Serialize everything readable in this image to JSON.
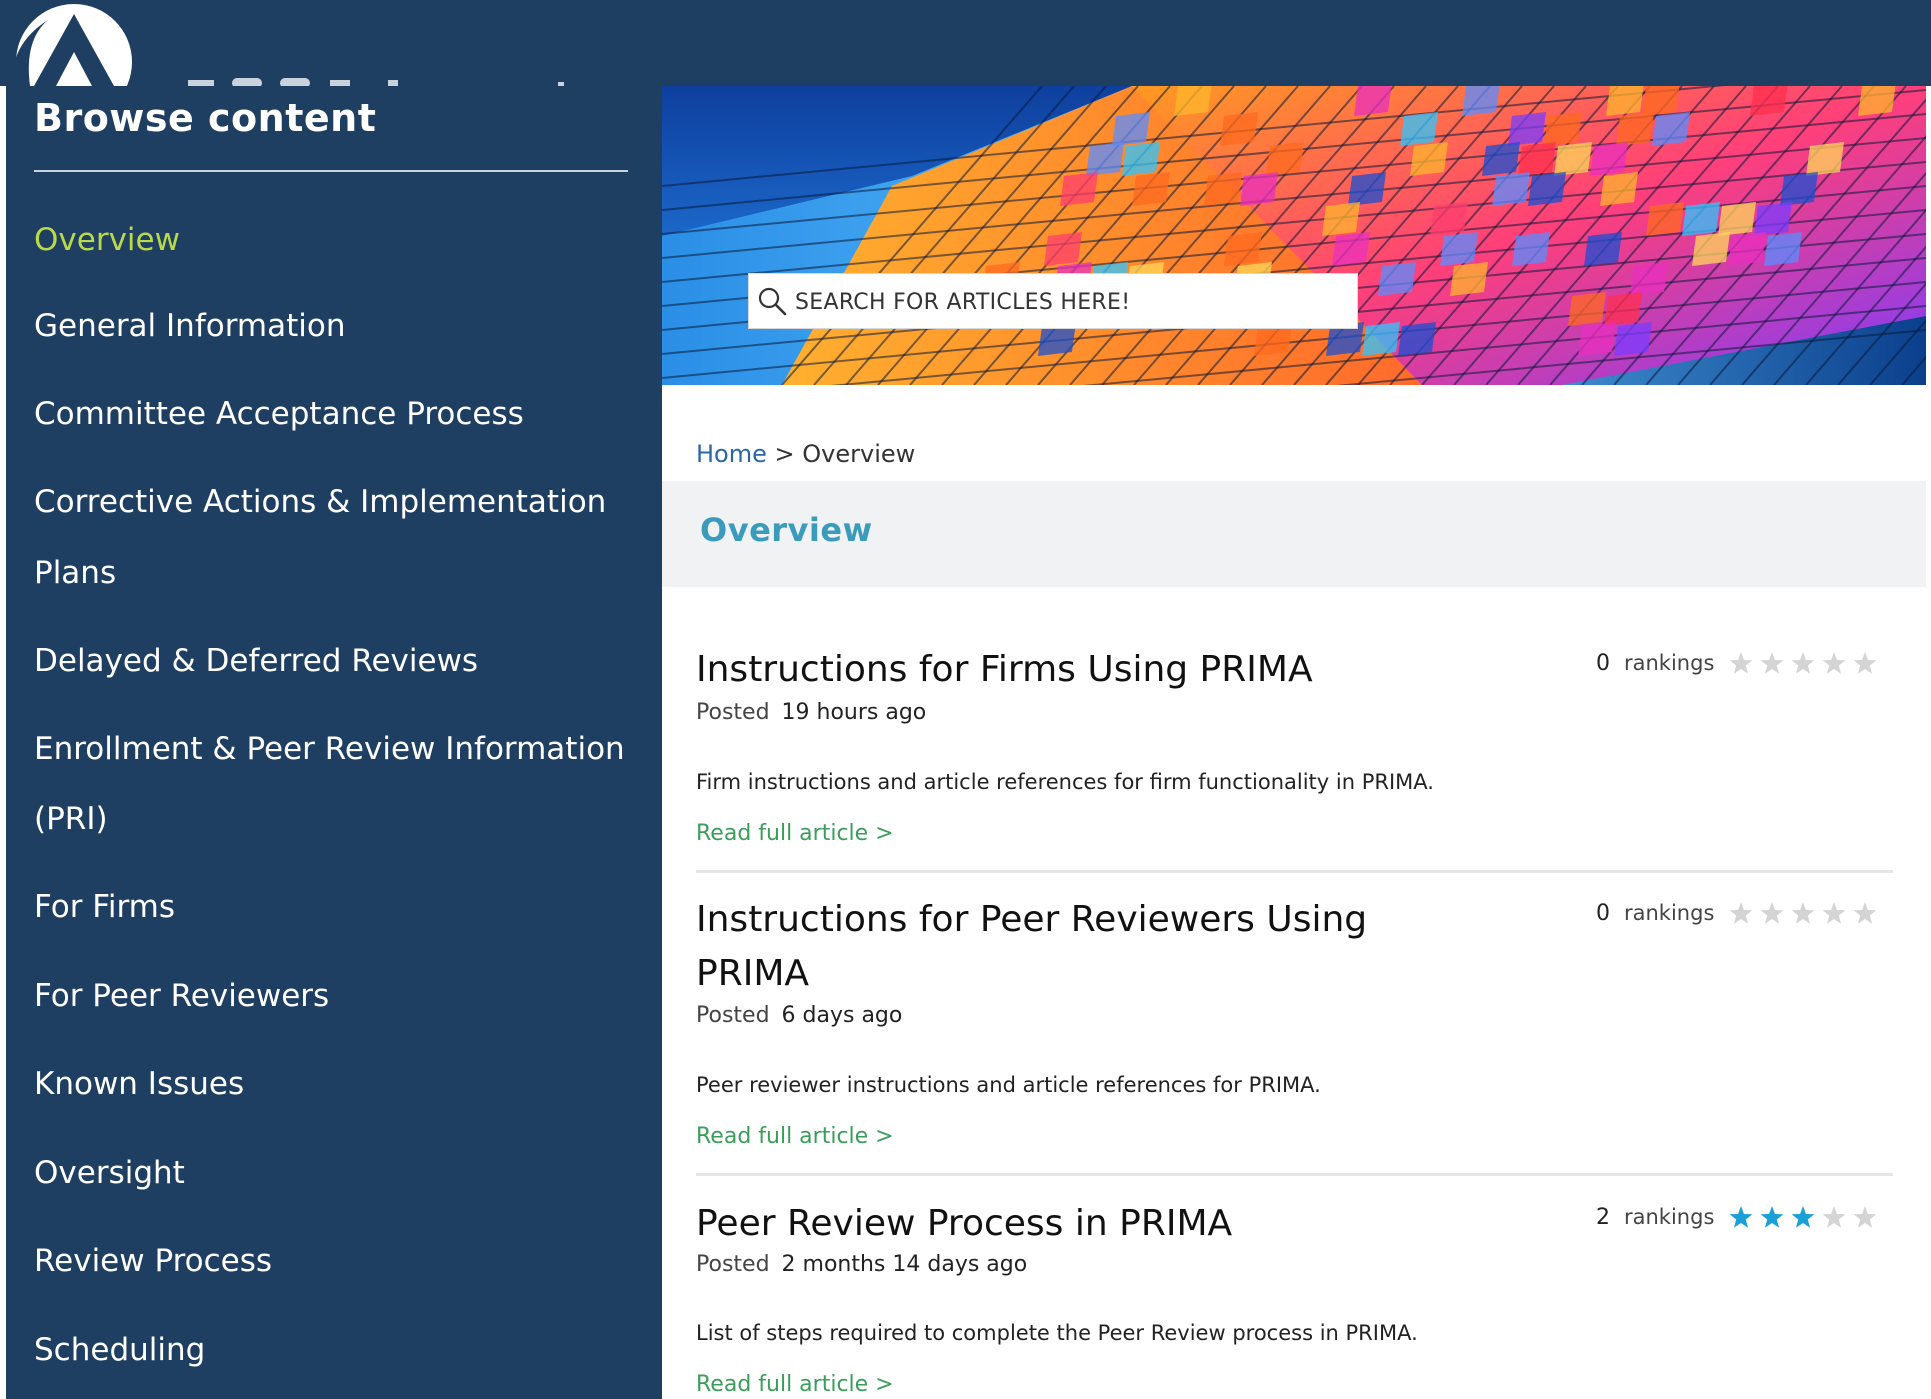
{
  "sidebar": {
    "title": "Browse content",
    "items": [
      {
        "label": "Overview",
        "active": true
      },
      {
        "label": "General Information"
      },
      {
        "label": "Committee Acceptance Process"
      },
      {
        "label": "Corrective Actions & Implementation"
      },
      {
        "label": "Plans"
      },
      {
        "label": "Delayed & Deferred Reviews"
      },
      {
        "label": "Enrollment & Peer Review Information"
      },
      {
        "label": "(PRI)"
      },
      {
        "label": "For Firms"
      },
      {
        "label": "For Peer Reviewers"
      },
      {
        "label": "Known Issues"
      },
      {
        "label": "Oversight"
      },
      {
        "label": "Review Process"
      },
      {
        "label": "Scheduling"
      }
    ]
  },
  "search": {
    "placeholder": "SEARCH FOR ARTICLES HERE!",
    "icon": "search-icon"
  },
  "breadcrumb": {
    "home": "Home",
    "separator": ">",
    "current": "Overview"
  },
  "page_title": "Overview",
  "articles": [
    {
      "title": "Instructions for Firms Using PRIMA",
      "posted_label": "Posted",
      "posted": "19 hours ago",
      "description": "Firm instructions and article references for firm functionality in PRIMA.",
      "read_more": "Read full article >",
      "rankings_count": "0",
      "rankings_label": "rankings",
      "stars_filled": 0
    },
    {
      "title": "Instructions for Peer Reviewers Using PRIMA",
      "posted_label": "Posted",
      "posted": "6 days ago",
      "description": "Peer reviewer instructions and article references for PRIMA.",
      "read_more": "Read full article >",
      "rankings_count": "0",
      "rankings_label": "rankings",
      "stars_filled": 0
    },
    {
      "title": "Peer Review Process in PRIMA",
      "posted_label": "Posted",
      "posted": "2 months 14 days ago",
      "description": "List of steps required to complete the Peer Review process in PRIMA.",
      "read_more": "Read full article >",
      "rankings_count": "2",
      "rankings_label": "rankings",
      "stars_filled": 3
    }
  ],
  "colors": {
    "navy": "#1f3f62",
    "active_nav": "#b8d94a",
    "overview_title": "#3a9bbd",
    "link_green": "#3a9e5a",
    "star_filled": "#1a9fd8",
    "star_empty": "#d4d4d4"
  }
}
